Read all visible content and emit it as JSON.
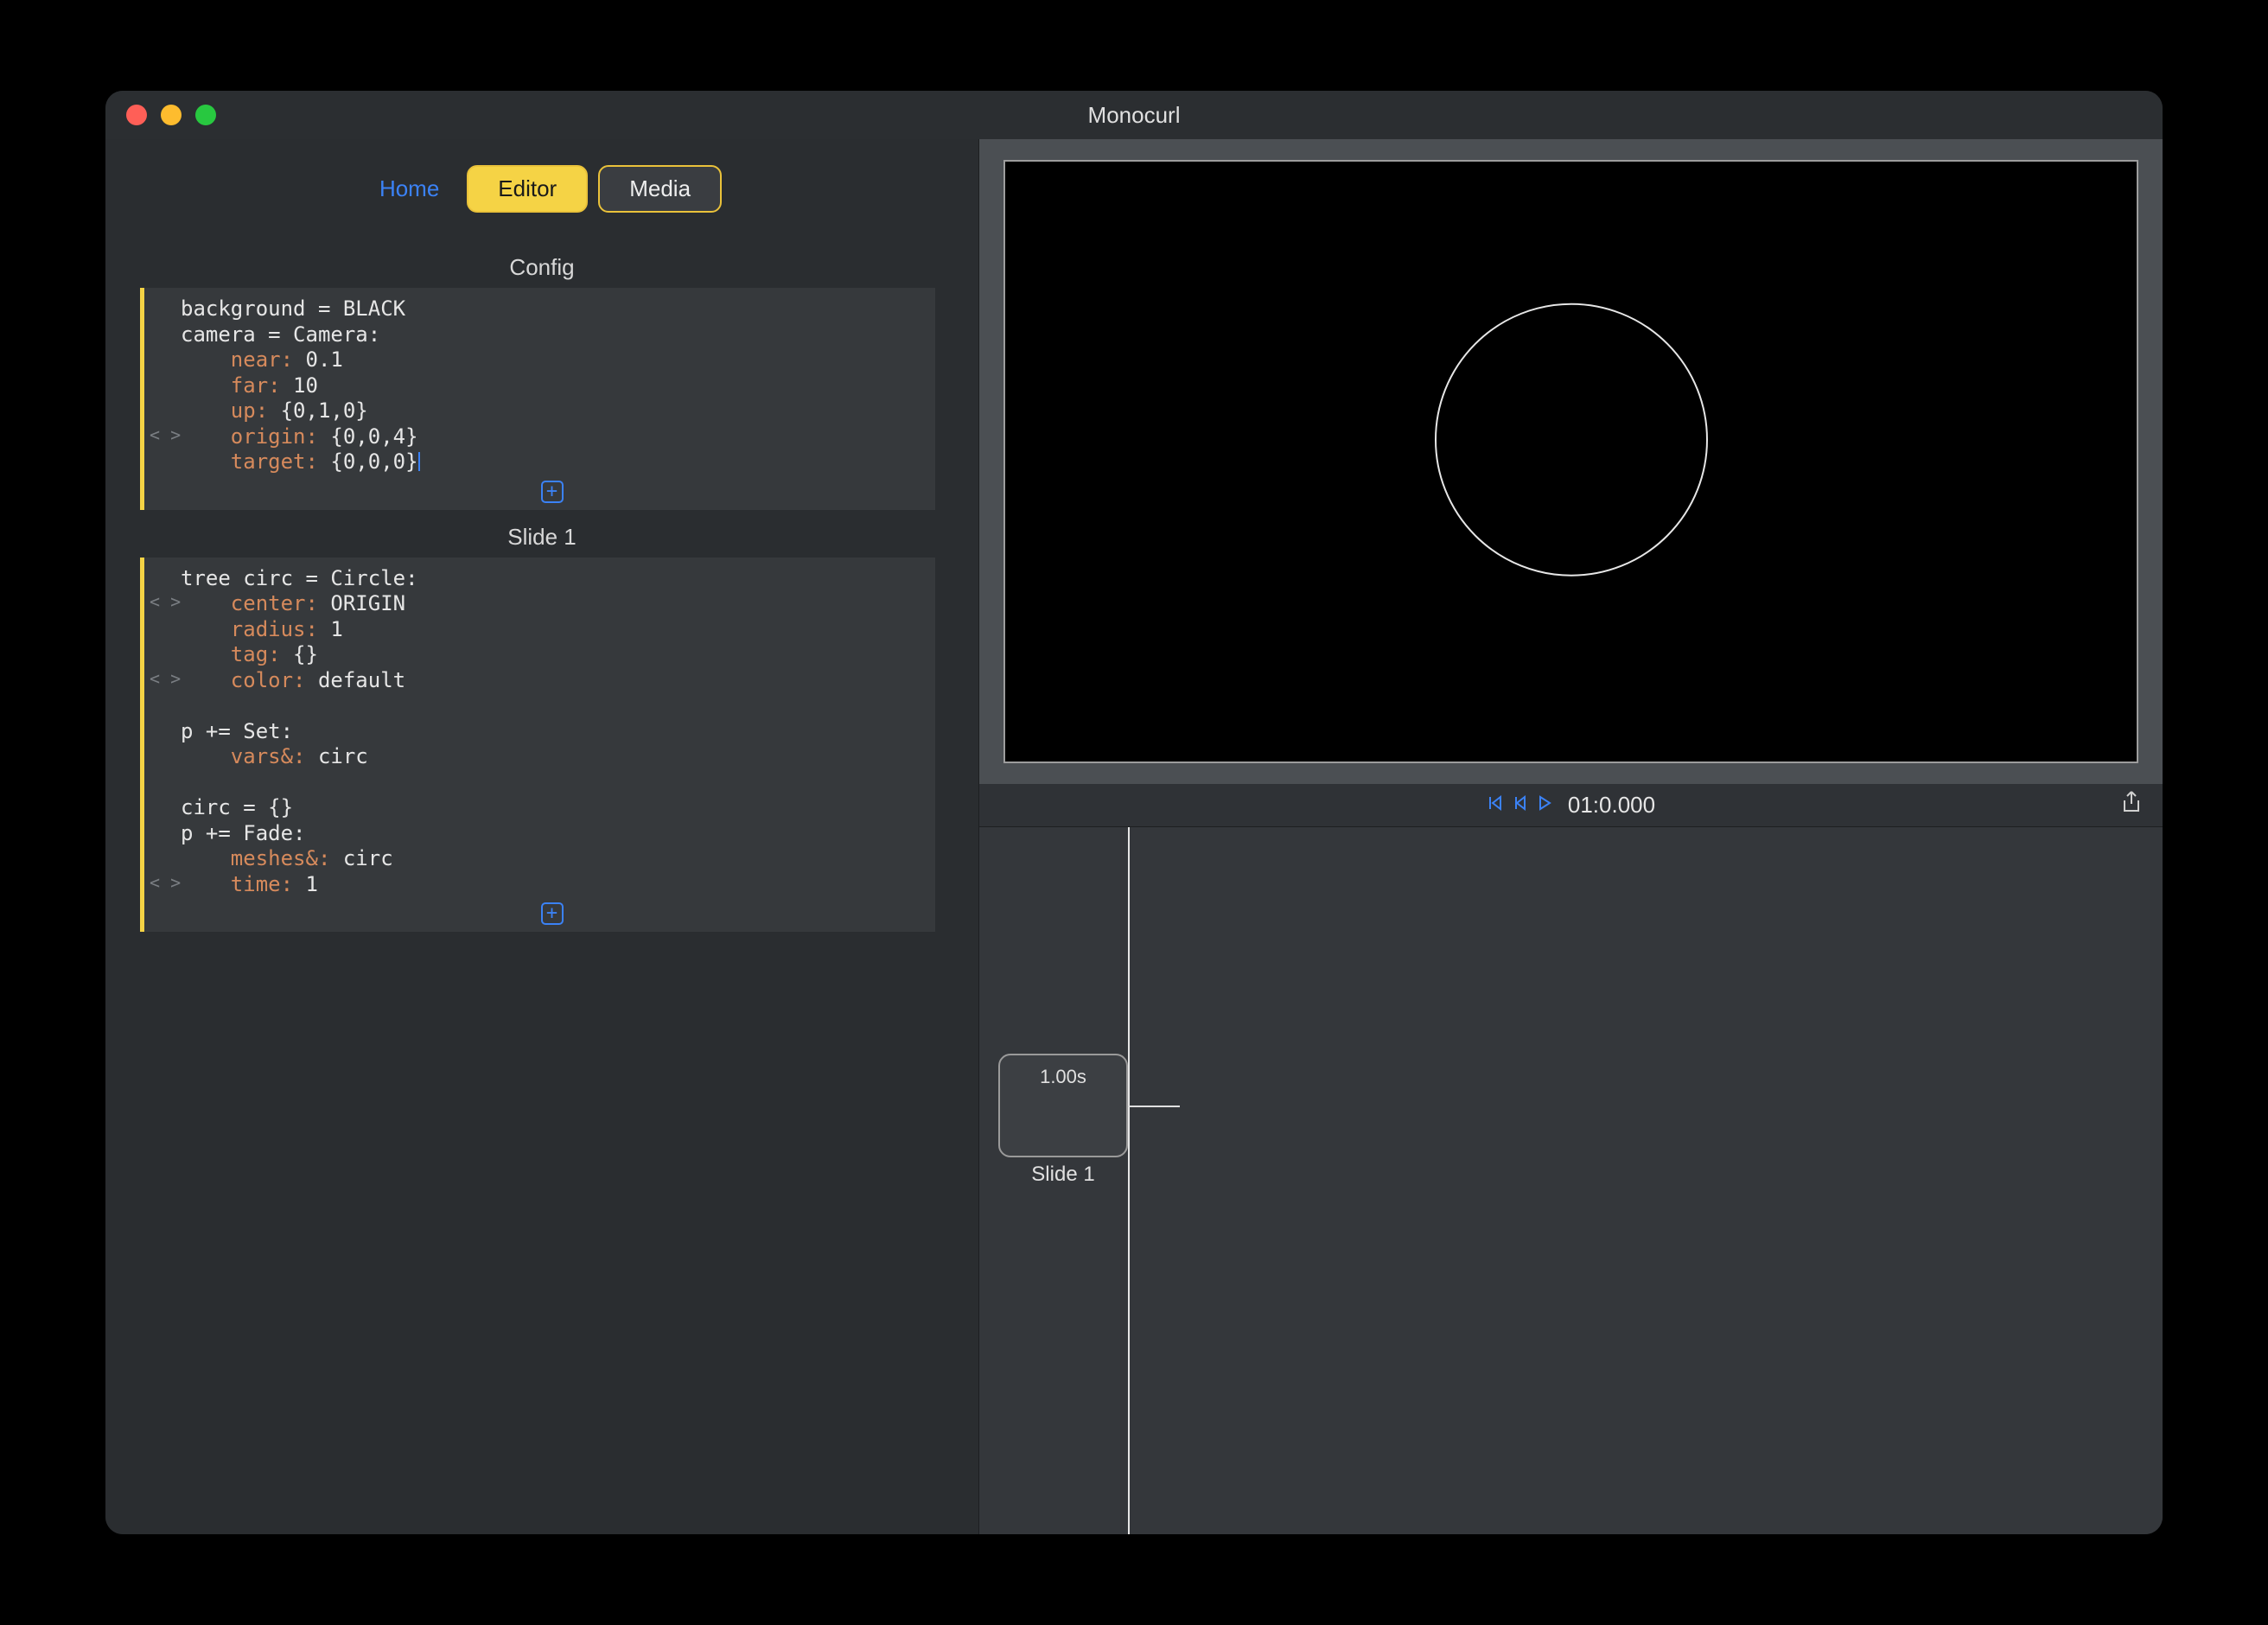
{
  "window": {
    "title": "Monocurl"
  },
  "tabs": {
    "home": "Home",
    "editor": "Editor",
    "media": "Media"
  },
  "sections": {
    "config_title": "Config",
    "slide1_title": "Slide 1"
  },
  "code": {
    "config": {
      "l0": "background = BLACK",
      "l1": "camera = Camera:",
      "l2_k": "near:",
      "l2_v": " 0.1",
      "l3_k": "far:",
      "l3_v": " 10",
      "l4_k": "up:",
      "l4_v": " {0,1,0}",
      "l5_k": "origin:",
      "l5_v": " {0,0,4}",
      "l6_k": "target:",
      "l6_v": " {0,0,0}"
    },
    "slide1": {
      "l0": "tree circ = Circle:",
      "l1_k": "center:",
      "l1_v": " ORIGIN",
      "l2_k": "radius:",
      "l2_v": " 1",
      "l3_k": "tag:",
      "l3_v": " {}",
      "l4_k": "color:",
      "l4_v": " default",
      "blank1": "",
      "l5": "p += Set:",
      "l6_k": "vars&:",
      "l6_v": " circ",
      "blank2": "",
      "l7": "circ = {}",
      "l8": "p += Fade:",
      "l9_k": "meshes&:",
      "l9_v": " circ",
      "l10_k": "time:",
      "l10_v": " 1"
    }
  },
  "gutter": {
    "fold": "< >"
  },
  "add": {
    "plus": "+"
  },
  "playback": {
    "timestamp": "01:0.000"
  },
  "timeline": {
    "slide_duration": "1.00s",
    "slide_label": "Slide 1"
  }
}
